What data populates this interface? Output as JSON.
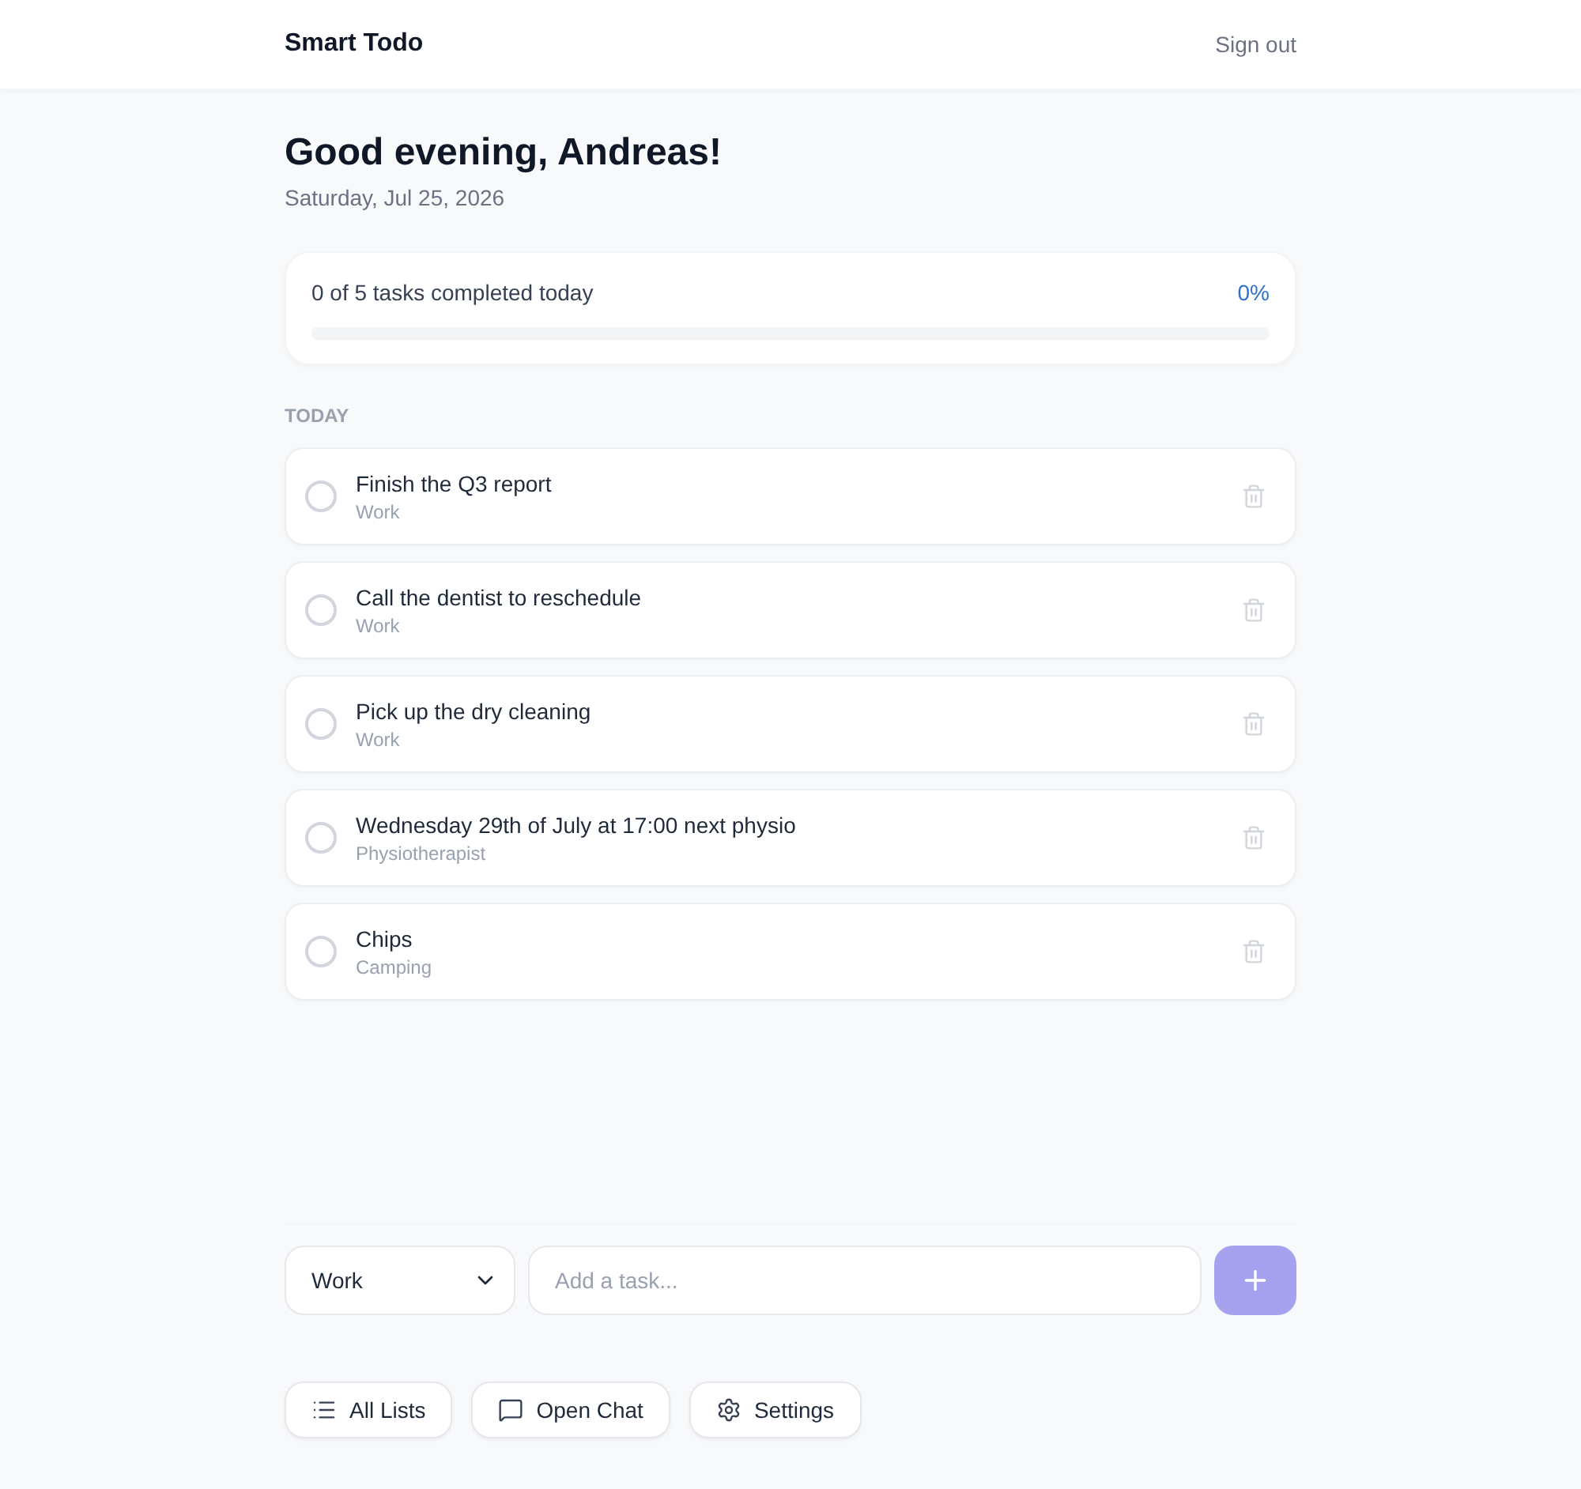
{
  "header": {
    "title": "Smart Todo",
    "sign_out": "Sign out"
  },
  "greeting": {
    "title": "Good evening, Andreas!",
    "date": "Saturday, Jul 25, 2026"
  },
  "progress": {
    "label": "0 of 5 tasks completed today",
    "percent": "0%",
    "level": 0
  },
  "section": {
    "title": "TODAY"
  },
  "tasks": [
    {
      "title": "Finish the Q3 report",
      "list": "Work",
      "completed": false
    },
    {
      "title": "Call the dentist to reschedule",
      "list": "Work",
      "completed": false
    },
    {
      "title": "Pick up the dry cleaning",
      "list": "Work",
      "completed": false
    },
    {
      "title": "Wednesday 29th of July at 17:00 next physio",
      "list": "Physiotherapist",
      "completed": false
    },
    {
      "title": "Chips",
      "list": "Camping",
      "completed": false
    }
  ],
  "composer": {
    "list": "Work",
    "placeholder": "Add a task...",
    "add_disabled": true
  },
  "nav": [
    {
      "label": "All Lists",
      "kind": "lists"
    },
    {
      "label": "Open Chat",
      "kind": "chat"
    },
    {
      "label": "Settings",
      "kind": "settings"
    }
  ]
}
